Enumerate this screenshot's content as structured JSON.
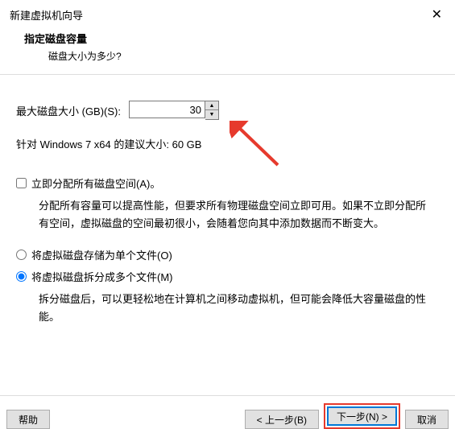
{
  "window": {
    "title": "新建虚拟机向导",
    "close_glyph": "✕"
  },
  "header": {
    "title": "指定磁盘容量",
    "subtitle": "磁盘大小为多少?"
  },
  "field": {
    "label": "最大磁盘大小 (GB)(S):",
    "value": "30",
    "spin_up": "▲",
    "spin_down": "▼"
  },
  "hint": "针对 Windows 7 x64 的建议大小: 60 GB",
  "allocate": {
    "label": "立即分配所有磁盘空间(A)。",
    "desc": "分配所有容量可以提高性能，但要求所有物理磁盘空间立即可用。如果不立即分配所有空间，虚拟磁盘的空间最初很小，会随着您向其中添加数据而不断变大。"
  },
  "store": {
    "single_label": "将虚拟磁盘存储为单个文件(O)",
    "split_label": "将虚拟磁盘拆分成多个文件(M)",
    "split_desc": "拆分磁盘后，可以更轻松地在计算机之间移动虚拟机，但可能会降低大容量磁盘的性能。"
  },
  "footer": {
    "help": "帮助",
    "back": "< 上一步(B)",
    "next": "下一步(N) >",
    "cancel": "取消"
  }
}
